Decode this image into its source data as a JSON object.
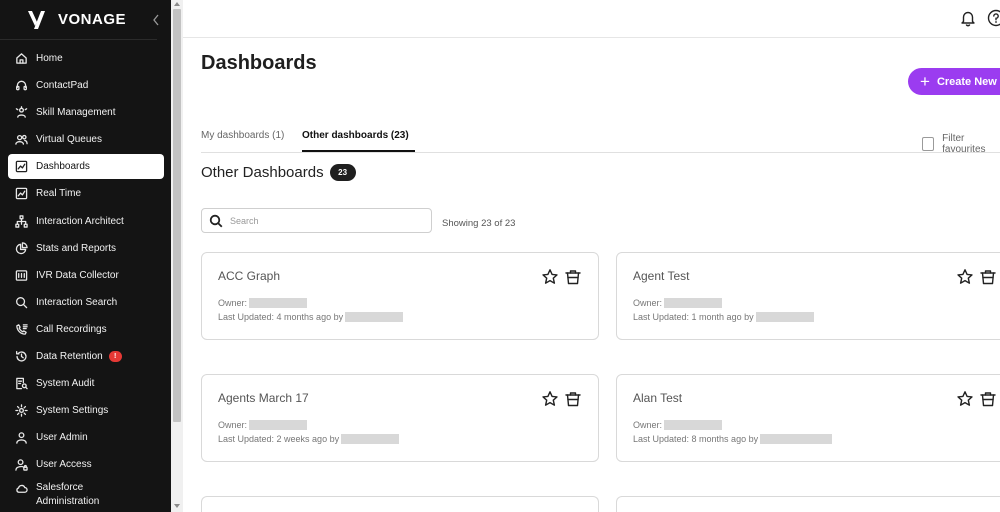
{
  "brand": {
    "name": "VONAGE"
  },
  "sidebar": {
    "items": [
      {
        "label": "Home",
        "icon": "home-icon"
      },
      {
        "label": "ContactPad",
        "icon": "headset-icon"
      },
      {
        "label": "Skill Management",
        "icon": "skill-icon"
      },
      {
        "label": "Virtual Queues",
        "icon": "users-icon"
      },
      {
        "label": "Dashboards",
        "icon": "chart-icon",
        "active": true
      },
      {
        "label": "Real Time",
        "icon": "realtime-chart-icon"
      },
      {
        "label": "Interaction Architect",
        "icon": "hierarchy-icon"
      },
      {
        "label": "Stats and Reports",
        "icon": "pie-chart-icon"
      },
      {
        "label": "IVR Data Collector",
        "icon": "ivr-icon"
      },
      {
        "label": "Interaction Search",
        "icon": "search-icon"
      },
      {
        "label": "Call Recordings",
        "icon": "recording-icon"
      },
      {
        "label": "Data Retention",
        "icon": "history-icon",
        "badge": "!"
      },
      {
        "label": "System Audit",
        "icon": "audit-icon"
      },
      {
        "label": "System Settings",
        "icon": "gear-icon"
      },
      {
        "label": "User Admin",
        "icon": "user-icon"
      },
      {
        "label": "User Access",
        "icon": "user-access-icon"
      },
      {
        "label": "Salesforce Administration",
        "icon": "cloud-icon"
      }
    ]
  },
  "main": {
    "title": "Dashboards",
    "create_label": "Create New",
    "tabs": [
      {
        "label": "My dashboards (1)"
      },
      {
        "label": "Other dashboards (23)",
        "active": true
      }
    ],
    "filter_label": "Filter favourites",
    "section_title": "Other Dashboards",
    "section_count": "23",
    "search_placeholder": "Search",
    "showing_text": "Showing 23 of 23",
    "owner_prefix": "Owner:",
    "cards": [
      {
        "name": "ACC Graph",
        "updated": "Last Updated: 4 months ago by"
      },
      {
        "name": "Agent Test",
        "updated": "Last Updated: 1 month ago by"
      },
      {
        "name": "Agents March 17",
        "updated": "Last Updated: 2 weeks ago by"
      },
      {
        "name": "Alan Test",
        "updated": "Last Updated: 8 months ago by"
      }
    ]
  },
  "colors": {
    "sidebar_bg": "#141414",
    "accent": "#9b3cf0",
    "badge_red": "#e53935"
  }
}
